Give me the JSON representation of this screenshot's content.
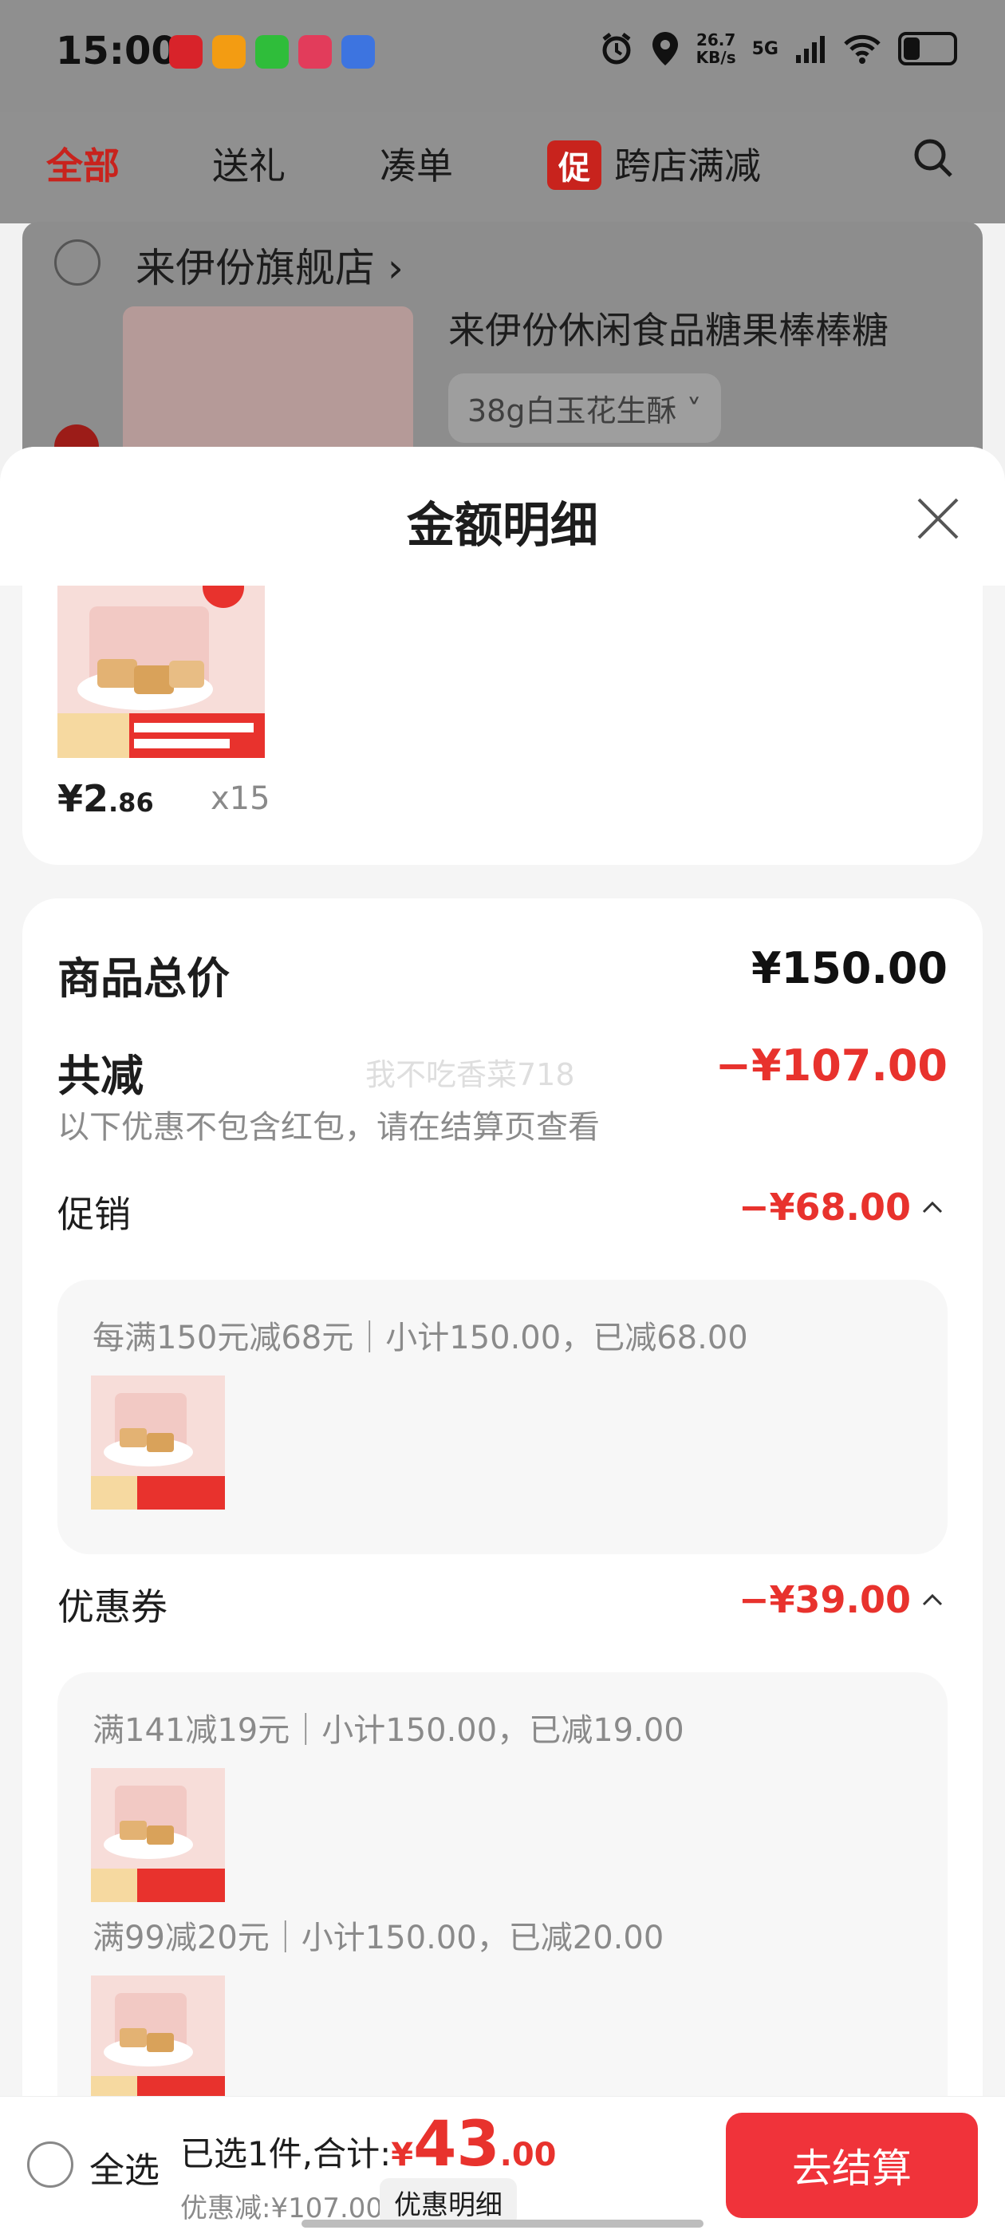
{
  "status_bar": {
    "time": "15:00",
    "speed_value": "26.7",
    "speed_unit": "KB/s",
    "network": "5G",
    "battery_percent": 34,
    "icons": [
      "app-icon-1",
      "app-icon-2",
      "wechat-icon",
      "app-icon-618",
      "app-icon-blue",
      "alarm-icon",
      "location-icon",
      "signal-icon",
      "wifi-icon",
      "battery-icon"
    ]
  },
  "tabs": {
    "all": "全部",
    "gift": "送礼",
    "bundle": "凑单",
    "promo_badge": "促",
    "cross_store": "跨店满减"
  },
  "store": {
    "name": "来伊份旗舰店",
    "product_title": "来伊份休闲食品糖果棒棒糖",
    "sku": "38g白玉花生酥"
  },
  "sheet": {
    "title": "金额明细",
    "product": {
      "price_main": "¥2",
      "price_decimal": ".86",
      "quantity": "x15"
    },
    "total_label": "商品总价",
    "total_value": "¥150.00",
    "reduce_label": "共减",
    "reduce_value": "−¥107.00",
    "reduce_note": "以下优惠不包含红包，请在结算页查看",
    "watermark": "我不吃香菜718",
    "promotion": {
      "label": "促销",
      "value": "−¥68.00",
      "rule": "每满150元减68元｜小计150.00，已减68.00"
    },
    "coupon": {
      "label": "优惠券",
      "value": "−¥39.00",
      "rule1": "满141减19元｜小计150.00，已减19.00",
      "rule2": "满99减20元｜小计150.00，已减20.00"
    }
  },
  "bottom": {
    "select_all": "全选",
    "selected_text": "已选1件,合计:",
    "currency": "¥",
    "total_int": "43",
    "total_dec": ".00",
    "discount": "优惠减:¥107.00",
    "detail_label": "优惠明细",
    "checkout": "去结算"
  },
  "colors": {
    "accent_red": "#e8322d",
    "button_red": "#f0333a"
  }
}
